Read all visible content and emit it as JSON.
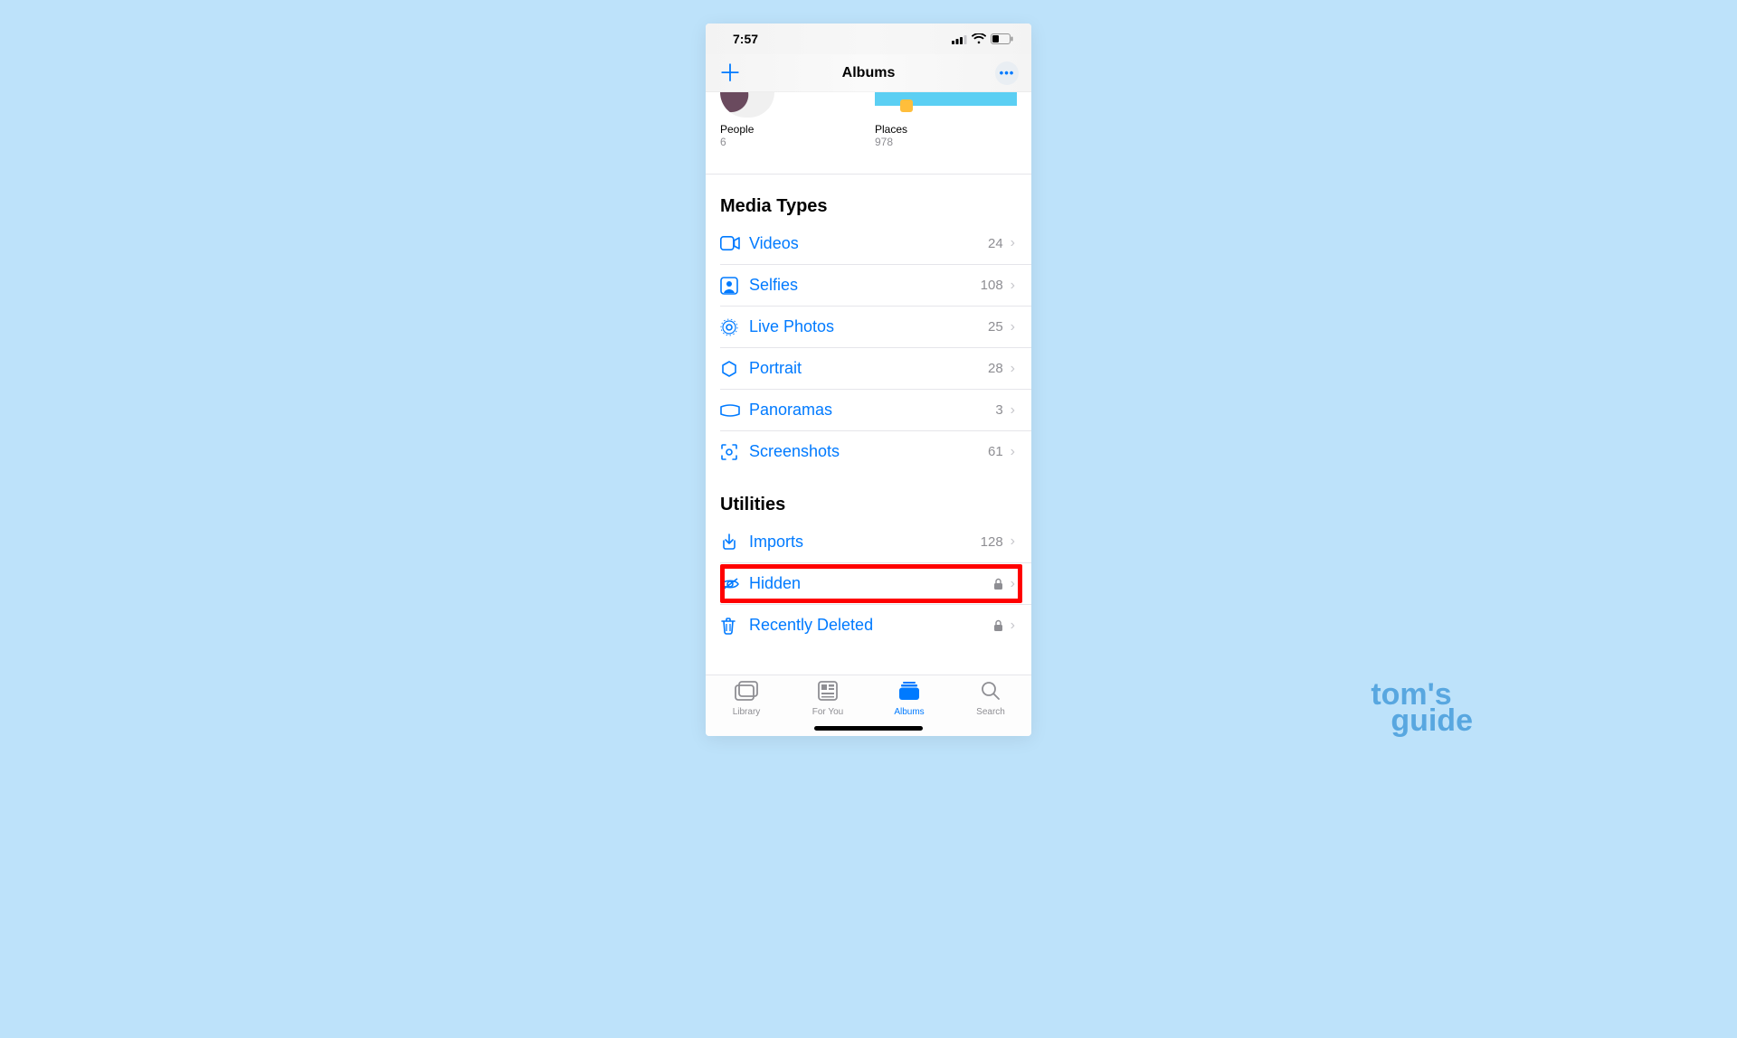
{
  "statusbar": {
    "time": "7:57"
  },
  "navbar": {
    "title": "Albums"
  },
  "pp": {
    "people": {
      "label": "People",
      "count": "6"
    },
    "places": {
      "label": "Places",
      "count": "978"
    }
  },
  "sections": {
    "media_types_title": "Media Types",
    "utilities_title": "Utilities"
  },
  "media_types": [
    {
      "label": "Videos",
      "count": "24"
    },
    {
      "label": "Selfies",
      "count": "108"
    },
    {
      "label": "Live Photos",
      "count": "25"
    },
    {
      "label": "Portrait",
      "count": "28"
    },
    {
      "label": "Panoramas",
      "count": "3"
    },
    {
      "label": "Screenshots",
      "count": "61"
    }
  ],
  "utilities": [
    {
      "label": "Imports",
      "count": "128",
      "locked": false
    },
    {
      "label": "Hidden",
      "count": "",
      "locked": true
    },
    {
      "label": "Recently Deleted",
      "count": "",
      "locked": true
    }
  ],
  "tabs": {
    "library": "Library",
    "for_you": "For You",
    "albums": "Albums",
    "search": "Search"
  },
  "watermark": {
    "line1": "tom's",
    "line2": "guide"
  }
}
